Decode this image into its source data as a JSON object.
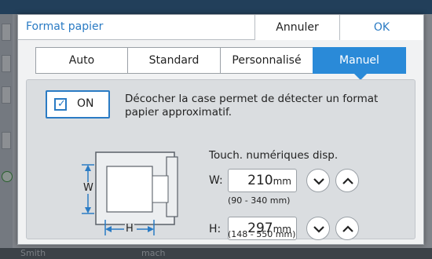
{
  "background": {
    "bottom_left_text": "Smith",
    "bottom_mid_text": "mach"
  },
  "dialog": {
    "title": "Format papier",
    "cancel_label": "Annuler",
    "ok_label": "OK"
  },
  "tabs": [
    {
      "label": "Auto",
      "active": false
    },
    {
      "label": "Standard",
      "active": false
    },
    {
      "label": "Personnalisé",
      "active": false
    },
    {
      "label": "Manuel",
      "active": true
    }
  ],
  "toggle": {
    "label": "ON",
    "checked": true
  },
  "description": "Décocher la case permet de détecter un format papier approximatif.",
  "numeric_keys_label": "Touch. numériques disp.",
  "width": {
    "label": "W:",
    "value": "210",
    "unit": "mm",
    "range": "(90 - 340 mm)"
  },
  "height": {
    "label": "H:",
    "value": "297",
    "unit": "mm",
    "range": "(148 - 550 mm)"
  },
  "illustration": {
    "w_label": "W",
    "h_label": "H"
  },
  "colors": {
    "accent": "#2a8ad8",
    "title_color": "#2a7bc4"
  }
}
